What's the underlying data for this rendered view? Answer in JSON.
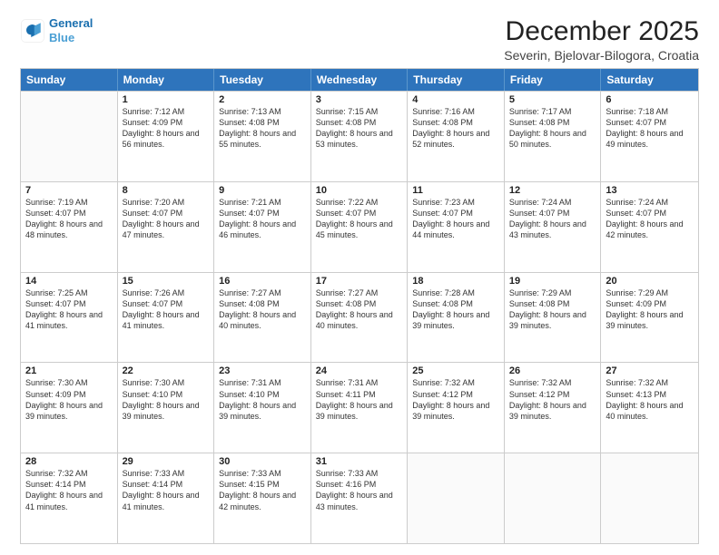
{
  "logo": {
    "line1": "General",
    "line2": "Blue"
  },
  "title": "December 2025",
  "location": "Severin, Bjelovar-Bilogora, Croatia",
  "days_of_week": [
    "Sunday",
    "Monday",
    "Tuesday",
    "Wednesday",
    "Thursday",
    "Friday",
    "Saturday"
  ],
  "weeks": [
    [
      {
        "day": "",
        "empty": true
      },
      {
        "day": "1",
        "rise": "7:12 AM",
        "set": "4:09 PM",
        "daylight": "8 hours and 56 minutes."
      },
      {
        "day": "2",
        "rise": "7:13 AM",
        "set": "4:08 PM",
        "daylight": "8 hours and 55 minutes."
      },
      {
        "day": "3",
        "rise": "7:15 AM",
        "set": "4:08 PM",
        "daylight": "8 hours and 53 minutes."
      },
      {
        "day": "4",
        "rise": "7:16 AM",
        "set": "4:08 PM",
        "daylight": "8 hours and 52 minutes."
      },
      {
        "day": "5",
        "rise": "7:17 AM",
        "set": "4:08 PM",
        "daylight": "8 hours and 50 minutes."
      },
      {
        "day": "6",
        "rise": "7:18 AM",
        "set": "4:07 PM",
        "daylight": "8 hours and 49 minutes."
      }
    ],
    [
      {
        "day": "7",
        "rise": "7:19 AM",
        "set": "4:07 PM",
        "daylight": "8 hours and 48 minutes."
      },
      {
        "day": "8",
        "rise": "7:20 AM",
        "set": "4:07 PM",
        "daylight": "8 hours and 47 minutes."
      },
      {
        "day": "9",
        "rise": "7:21 AM",
        "set": "4:07 PM",
        "daylight": "8 hours and 46 minutes."
      },
      {
        "day": "10",
        "rise": "7:22 AM",
        "set": "4:07 PM",
        "daylight": "8 hours and 45 minutes."
      },
      {
        "day": "11",
        "rise": "7:23 AM",
        "set": "4:07 PM",
        "daylight": "8 hours and 44 minutes."
      },
      {
        "day": "12",
        "rise": "7:24 AM",
        "set": "4:07 PM",
        "daylight": "8 hours and 43 minutes."
      },
      {
        "day": "13",
        "rise": "7:24 AM",
        "set": "4:07 PM",
        "daylight": "8 hours and 42 minutes."
      }
    ],
    [
      {
        "day": "14",
        "rise": "7:25 AM",
        "set": "4:07 PM",
        "daylight": "8 hours and 41 minutes."
      },
      {
        "day": "15",
        "rise": "7:26 AM",
        "set": "4:07 PM",
        "daylight": "8 hours and 41 minutes."
      },
      {
        "day": "16",
        "rise": "7:27 AM",
        "set": "4:08 PM",
        "daylight": "8 hours and 40 minutes."
      },
      {
        "day": "17",
        "rise": "7:27 AM",
        "set": "4:08 PM",
        "daylight": "8 hours and 40 minutes."
      },
      {
        "day": "18",
        "rise": "7:28 AM",
        "set": "4:08 PM",
        "daylight": "8 hours and 39 minutes."
      },
      {
        "day": "19",
        "rise": "7:29 AM",
        "set": "4:08 PM",
        "daylight": "8 hours and 39 minutes."
      },
      {
        "day": "20",
        "rise": "7:29 AM",
        "set": "4:09 PM",
        "daylight": "8 hours and 39 minutes."
      }
    ],
    [
      {
        "day": "21",
        "rise": "7:30 AM",
        "set": "4:09 PM",
        "daylight": "8 hours and 39 minutes."
      },
      {
        "day": "22",
        "rise": "7:30 AM",
        "set": "4:10 PM",
        "daylight": "8 hours and 39 minutes."
      },
      {
        "day": "23",
        "rise": "7:31 AM",
        "set": "4:10 PM",
        "daylight": "8 hours and 39 minutes."
      },
      {
        "day": "24",
        "rise": "7:31 AM",
        "set": "4:11 PM",
        "daylight": "8 hours and 39 minutes."
      },
      {
        "day": "25",
        "rise": "7:32 AM",
        "set": "4:12 PM",
        "daylight": "8 hours and 39 minutes."
      },
      {
        "day": "26",
        "rise": "7:32 AM",
        "set": "4:12 PM",
        "daylight": "8 hours and 39 minutes."
      },
      {
        "day": "27",
        "rise": "7:32 AM",
        "set": "4:13 PM",
        "daylight": "8 hours and 40 minutes."
      }
    ],
    [
      {
        "day": "28",
        "rise": "7:32 AM",
        "set": "4:14 PM",
        "daylight": "8 hours and 41 minutes."
      },
      {
        "day": "29",
        "rise": "7:33 AM",
        "set": "4:14 PM",
        "daylight": "8 hours and 41 minutes."
      },
      {
        "day": "30",
        "rise": "7:33 AM",
        "set": "4:15 PM",
        "daylight": "8 hours and 42 minutes."
      },
      {
        "day": "31",
        "rise": "7:33 AM",
        "set": "4:16 PM",
        "daylight": "8 hours and 43 minutes."
      },
      {
        "day": "",
        "empty": true
      },
      {
        "day": "",
        "empty": true
      },
      {
        "day": "",
        "empty": true
      }
    ]
  ]
}
